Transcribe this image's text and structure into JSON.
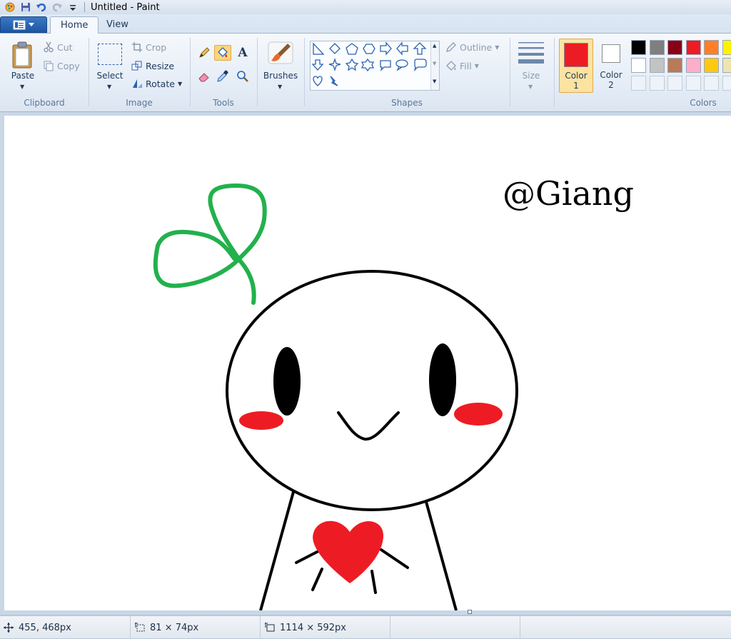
{
  "window": {
    "title": "Untitled - Paint"
  },
  "tabs": [
    {
      "label": "Home",
      "active": true
    },
    {
      "label": "View",
      "active": false
    }
  ],
  "ribbon": {
    "clipboard": {
      "group_label": "Clipboard",
      "paste": "Paste",
      "cut": "Cut",
      "copy": "Copy"
    },
    "image": {
      "group_label": "Image",
      "select": "Select",
      "crop": "Crop",
      "resize": "Resize",
      "rotate": "Rotate"
    },
    "tools": {
      "group_label": "Tools",
      "icons": [
        "pencil-icon",
        "fill-icon",
        "text-icon",
        "eraser-icon",
        "color-picker-icon",
        "magnifier-icon"
      ],
      "active": "fill-icon"
    },
    "brushes": {
      "label": "Brushes"
    },
    "shapes": {
      "group_label": "Shapes",
      "outline": "Outline",
      "fill": "Fill"
    },
    "size": {
      "label": "Size"
    },
    "color1": {
      "label_line1": "Color",
      "label_line2": "1",
      "value": "#ed1c24"
    },
    "color2": {
      "label_line1": "Color",
      "label_line2": "2",
      "value": "#ffffff"
    },
    "colors": {
      "group_label": "Colors",
      "row1": [
        "#000000",
        "#7f7f7f",
        "#880015",
        "#ed1c24",
        "#ff7f27",
        "#fff200"
      ],
      "row2": [
        "#ffffff",
        "#c3c3c3",
        "#b97a57",
        "#ffaec9",
        "#ffc90e",
        "#efe4b0"
      ]
    }
  },
  "canvas": {
    "watermark": "@Giang"
  },
  "status": {
    "cursor_position": "455, 468px",
    "selection_size": "81 × 74px",
    "image_size": "1114 × 592px"
  }
}
